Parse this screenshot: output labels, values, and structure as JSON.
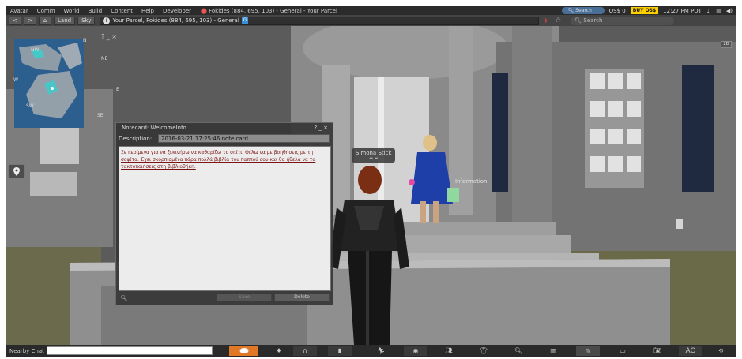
{
  "menu": {
    "items": [
      "Avatar",
      "Comm",
      "World",
      "Build",
      "Content",
      "Help",
      "Developer"
    ],
    "location": "Fokides (884, 695, 103) - General - Your Parcel",
    "search_menus": "Search Menus",
    "balance": "OS$ 0",
    "buy_label": "BUY OS$",
    "clock": "12:27 PM PDT"
  },
  "nav": {
    "land": "Land",
    "sky": "Sky",
    "address": "Your Parcel, Fokides (884, 695, 103) - General",
    "address_badge": "G",
    "search_placeholder": "Search"
  },
  "minimap": {
    "compass": {
      "n": "N",
      "ne": "NE",
      "nw": "NW",
      "e": "E",
      "se": "SE",
      "sw": "SW",
      "w": "W"
    },
    "controls": "? _ ×"
  },
  "view2d": "2D",
  "scene": {
    "avatar_name": "Simona Stick",
    "info_label": "Information"
  },
  "notecard": {
    "title": "Notecard: WelcomeInfo",
    "controls": "? _ ×",
    "description_label": "Description:",
    "description_value": "2016-03-21 17:25:46 note card",
    "body": "Σε περίμενα για να ξεκινήσω να καθαρίζω το σπίτι. Θέλω να με βοηθήσεις με τη σοφίτα. Έχει σκορπισμένα πάρα πολλά βιβλία του παππού σου και θα ήθελα να τα τακτοποιήσεις στη βιβλιοθήκη.",
    "save": "Save",
    "delete": "Delete"
  },
  "bottombar": {
    "nearby_chat": "Nearby Chat",
    "ao_label": "AO"
  },
  "colors": {
    "speak_button": "#e07828",
    "buy_button": "#ffd000",
    "notecard_text": "#7d1414",
    "address_badge": "#3b8fd6"
  }
}
